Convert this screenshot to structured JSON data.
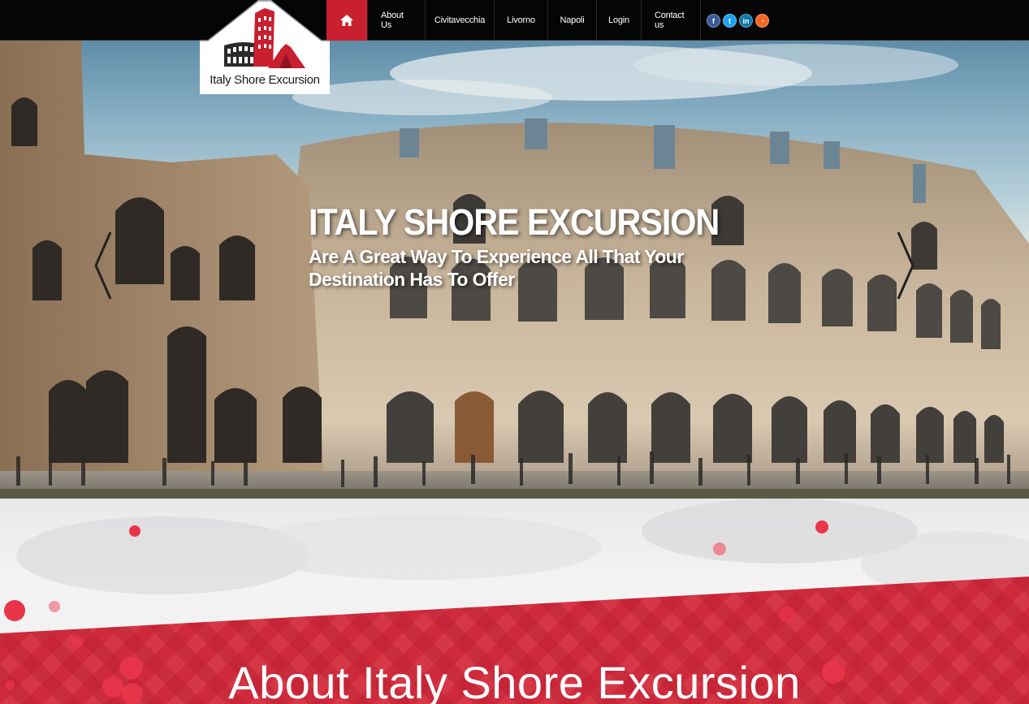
{
  "brand": {
    "name": "Italy Shore Excursion",
    "accent": "#c8202f"
  },
  "nav": {
    "home_icon": "home-icon",
    "items": [
      {
        "label": "About Us"
      },
      {
        "label": "Civitavecchia"
      },
      {
        "label": "Livorno"
      },
      {
        "label": "Napoli"
      },
      {
        "label": "Login"
      },
      {
        "label": "Contact us"
      }
    ],
    "social": [
      {
        "icon": "facebook-icon",
        "glyph": "f",
        "color": "#3b5998"
      },
      {
        "icon": "twitter-icon",
        "glyph": "t",
        "color": "#1da1f2"
      },
      {
        "icon": "linkedin-icon",
        "glyph": "in",
        "color": "#0e76a8"
      },
      {
        "icon": "rss-icon",
        "glyph": "◔",
        "color": "#f26522"
      }
    ]
  },
  "hero": {
    "title": "ITALY SHORE EXCURSION",
    "subtitle": "Are A Great Way To Experience All That Your Destination Has To Offer",
    "prev_icon": "chevron-left-icon",
    "next_icon": "chevron-right-icon"
  },
  "about": {
    "title": "About Italy Shore Excursion"
  }
}
